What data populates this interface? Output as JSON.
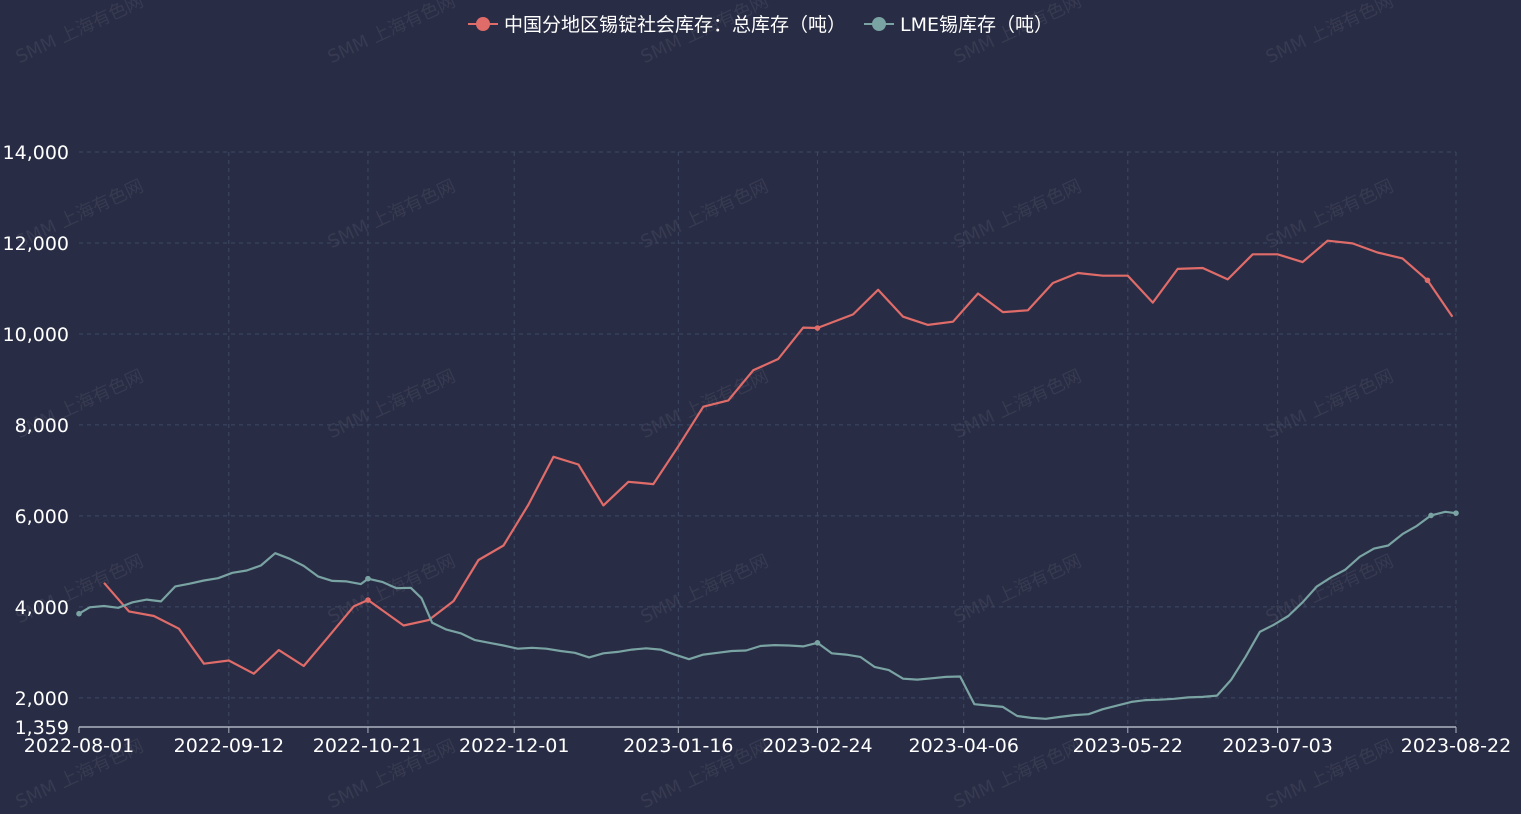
{
  "watermark": "SMM 上海有色网",
  "colors": {
    "background": "#282c44",
    "series_china": "#e06c6a",
    "series_lme": "#7aa3a3",
    "grid": "#3d4a63",
    "axis": "#aeb4c0",
    "text": "#ffffff"
  },
  "chart_data": {
    "type": "line",
    "grid": true,
    "legend_position": "top-center",
    "x_ticks": [
      "2022-08-01",
      "2022-09-12",
      "2022-10-21",
      "2022-12-01",
      "2023-01-16",
      "2023-02-24",
      "2023-04-06",
      "2023-05-22",
      "2023-07-03",
      "2023-08-22"
    ],
    "y_ticks": [
      1359,
      2000,
      4000,
      6000,
      8000,
      10000,
      12000,
      14000
    ],
    "y_tick_labels": [
      "1,359",
      "2,000",
      "4,000",
      "6,000",
      "8,000",
      "10,000",
      "12,000",
      "14,000"
    ],
    "ylim": [
      1359,
      14000
    ],
    "xlim": [
      "2022-08-01",
      "2023-08-22"
    ],
    "series": [
      {
        "name": "中国分地区锡锭社会库存：总库存（吨）",
        "color_key": "series_china",
        "points": [
          [
            "2022-08-08",
            4530
          ],
          [
            "2022-08-15",
            3900
          ],
          [
            "2022-08-22",
            3800
          ],
          [
            "2022-08-29",
            3520
          ],
          [
            "2022-09-05",
            2750
          ],
          [
            "2022-09-12",
            2820
          ],
          [
            "2022-09-19",
            2530
          ],
          [
            "2022-09-26",
            3050
          ],
          [
            "2022-10-03",
            2700
          ],
          [
            "2022-10-10",
            3350
          ],
          [
            "2022-10-17",
            4010
          ],
          [
            "2022-10-21",
            4150
          ],
          [
            "2022-10-31",
            3590
          ],
          [
            "2022-11-07",
            3710
          ],
          [
            "2022-11-14",
            4130
          ],
          [
            "2022-11-21",
            5030
          ],
          [
            "2022-11-28",
            5350
          ],
          [
            "2022-12-05",
            6250
          ],
          [
            "2022-12-12",
            7300
          ],
          [
            "2022-12-19",
            7130
          ],
          [
            "2022-12-26",
            6230
          ],
          [
            "2023-01-02",
            6750
          ],
          [
            "2023-01-09",
            6700
          ],
          [
            "2023-01-16",
            7530
          ],
          [
            "2023-01-23",
            8400
          ],
          [
            "2023-01-30",
            8540
          ],
          [
            "2023-02-06",
            9200
          ],
          [
            "2023-02-13",
            9450
          ],
          [
            "2023-02-20",
            10140
          ],
          [
            "2023-02-24",
            10130
          ],
          [
            "2023-03-06",
            10430
          ],
          [
            "2023-03-13",
            10970
          ],
          [
            "2023-03-20",
            10380
          ],
          [
            "2023-03-27",
            10200
          ],
          [
            "2023-04-03",
            10270
          ],
          [
            "2023-04-10",
            10890
          ],
          [
            "2023-04-17",
            10480
          ],
          [
            "2023-04-24",
            10520
          ],
          [
            "2023-05-01",
            11120
          ],
          [
            "2023-05-08",
            11340
          ],
          [
            "2023-05-15",
            11280
          ],
          [
            "2023-05-22",
            11280
          ],
          [
            "2023-05-29",
            10690
          ],
          [
            "2023-06-05",
            11430
          ],
          [
            "2023-06-12",
            11450
          ],
          [
            "2023-06-19",
            11200
          ],
          [
            "2023-06-26",
            11750
          ],
          [
            "2023-07-03",
            11750
          ],
          [
            "2023-07-10",
            11580
          ],
          [
            "2023-07-17",
            12050
          ],
          [
            "2023-07-24",
            11990
          ],
          [
            "2023-07-31",
            11790
          ],
          [
            "2023-08-07",
            11660
          ],
          [
            "2023-08-14",
            11180
          ],
          [
            "2023-08-21",
            10380
          ]
        ]
      },
      {
        "name": "LME锡库存（吨）",
        "color_key": "series_lme",
        "points": [
          [
            "2022-08-01",
            3850
          ],
          [
            "2022-08-04",
            3990
          ],
          [
            "2022-08-08",
            4020
          ],
          [
            "2022-08-12",
            3980
          ],
          [
            "2022-08-16",
            4100
          ],
          [
            "2022-08-20",
            4160
          ],
          [
            "2022-08-24",
            4120
          ],
          [
            "2022-08-28",
            4450
          ],
          [
            "2022-09-01",
            4510
          ],
          [
            "2022-09-05",
            4580
          ],
          [
            "2022-09-09",
            4630
          ],
          [
            "2022-09-13",
            4750
          ],
          [
            "2022-09-17",
            4800
          ],
          [
            "2022-09-21",
            4910
          ],
          [
            "2022-09-25",
            5180
          ],
          [
            "2022-09-29",
            5060
          ],
          [
            "2022-10-03",
            4900
          ],
          [
            "2022-10-07",
            4670
          ],
          [
            "2022-10-11",
            4570
          ],
          [
            "2022-10-15",
            4560
          ],
          [
            "2022-10-19",
            4500
          ],
          [
            "2022-10-21",
            4620
          ],
          [
            "2022-10-25",
            4550
          ],
          [
            "2022-10-29",
            4410
          ],
          [
            "2022-11-02",
            4420
          ],
          [
            "2022-11-05",
            4190
          ],
          [
            "2022-11-08",
            3650
          ],
          [
            "2022-11-12",
            3500
          ],
          [
            "2022-11-16",
            3420
          ],
          [
            "2022-11-20",
            3270
          ],
          [
            "2022-11-24",
            3210
          ],
          [
            "2022-11-28",
            3150
          ],
          [
            "2022-12-02",
            3080
          ],
          [
            "2022-12-06",
            3100
          ],
          [
            "2022-12-10",
            3080
          ],
          [
            "2022-12-14",
            3030
          ],
          [
            "2022-12-18",
            2990
          ],
          [
            "2022-12-22",
            2890
          ],
          [
            "2022-12-26",
            2980
          ],
          [
            "2022-12-30",
            3010
          ],
          [
            "2023-01-03",
            3060
          ],
          [
            "2023-01-07",
            3090
          ],
          [
            "2023-01-11",
            3060
          ],
          [
            "2023-01-15",
            2950
          ],
          [
            "2023-01-19",
            2850
          ],
          [
            "2023-01-23",
            2950
          ],
          [
            "2023-01-27",
            2990
          ],
          [
            "2023-01-31",
            3030
          ],
          [
            "2023-02-04",
            3040
          ],
          [
            "2023-02-08",
            3140
          ],
          [
            "2023-02-12",
            3160
          ],
          [
            "2023-02-16",
            3150
          ],
          [
            "2023-02-20",
            3130
          ],
          [
            "2023-02-24",
            3210
          ],
          [
            "2023-02-28",
            2980
          ],
          [
            "2023-03-04",
            2950
          ],
          [
            "2023-03-08",
            2900
          ],
          [
            "2023-03-12",
            2680
          ],
          [
            "2023-03-16",
            2610
          ],
          [
            "2023-03-20",
            2420
          ],
          [
            "2023-03-24",
            2400
          ],
          [
            "2023-03-28",
            2430
          ],
          [
            "2023-04-01",
            2460
          ],
          [
            "2023-04-05",
            2470
          ],
          [
            "2023-04-09",
            1860
          ],
          [
            "2023-04-13",
            1830
          ],
          [
            "2023-04-17",
            1800
          ],
          [
            "2023-04-21",
            1600
          ],
          [
            "2023-04-25",
            1560
          ],
          [
            "2023-04-29",
            1540
          ],
          [
            "2023-05-03",
            1580
          ],
          [
            "2023-05-07",
            1620
          ],
          [
            "2023-05-11",
            1640
          ],
          [
            "2023-05-15",
            1750
          ],
          [
            "2023-05-19",
            1830
          ],
          [
            "2023-05-23",
            1910
          ],
          [
            "2023-05-27",
            1950
          ],
          [
            "2023-05-31",
            1960
          ],
          [
            "2023-06-04",
            1980
          ],
          [
            "2023-06-08",
            2010
          ],
          [
            "2023-06-12",
            2020
          ],
          [
            "2023-06-16",
            2050
          ],
          [
            "2023-06-20",
            2400
          ],
          [
            "2023-06-24",
            2900
          ],
          [
            "2023-06-28",
            3450
          ],
          [
            "2023-07-02",
            3610
          ],
          [
            "2023-07-06",
            3800
          ],
          [
            "2023-07-10",
            4100
          ],
          [
            "2023-07-14",
            4450
          ],
          [
            "2023-07-18",
            4650
          ],
          [
            "2023-07-22",
            4820
          ],
          [
            "2023-07-26",
            5100
          ],
          [
            "2023-07-30",
            5280
          ],
          [
            "2023-08-03",
            5350
          ],
          [
            "2023-08-07",
            5600
          ],
          [
            "2023-08-11",
            5780
          ],
          [
            "2023-08-15",
            6010
          ],
          [
            "2023-08-19",
            6090
          ],
          [
            "2023-08-22",
            6060
          ]
        ]
      }
    ],
    "marked_points": {
      "series_china": [
        "2022-10-21",
        "2023-02-24",
        "2023-08-14"
      ],
      "series_lme": [
        "2022-08-01",
        "2022-09-12",
        "2022-10-21",
        "2022-12-01",
        "2023-01-16",
        "2023-02-24",
        "2023-04-06",
        "2023-05-22",
        "2023-07-03",
        "2023-08-15",
        "2023-08-22"
      ]
    }
  }
}
